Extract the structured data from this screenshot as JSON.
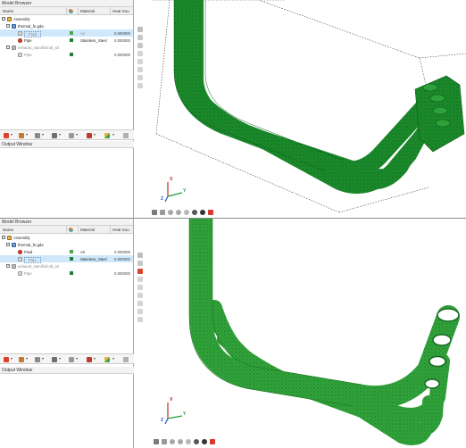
{
  "model_browser": {
    "title": "Model Browser",
    "columns": {
      "name": "Name",
      "material": "Material",
      "heat_source": "Heat Sou"
    }
  },
  "top": {
    "assembly_label": "Assembly",
    "component_1": "thermal_fe.gda",
    "part_fluid": "Fluid",
    "part_fluid_material": "Air",
    "part_fluid_heat": "0.000000",
    "part_pipe": "Pipe",
    "part_pipe_material": "Stainless_Steel",
    "part_pipe_heat": "0.000000",
    "component_2": "exhaust_manifold.stl_txt",
    "part_pipe2": "Pipe",
    "part_pipe2_heat": "0.000000"
  },
  "bottom": {
    "assembly_label": "Assembly",
    "component_1": "thermal_fe.gda",
    "part_fluid": "Fluid",
    "part_fluid_material": "Air",
    "part_fluid_heat": "0.000000",
    "part_pipe": "Pipe",
    "part_pipe_material": "Stainless_Steel",
    "part_pipe_heat": "0.000000",
    "component_2": "exhaust_manifold.stl_txt",
    "part_pipe2": "Pipe",
    "part_pipe2_heat": "0.000000"
  },
  "output_window": {
    "title": "Output Window"
  },
  "triad": {
    "x_label": "X",
    "y_label": "Y",
    "z_label": "Z"
  },
  "colors": {
    "mesh_green": "#1d8f2e",
    "mesh_light": "#3ab646",
    "selection_blue": "#cfe8fb",
    "swatch_air": "#4aa84a",
    "swatch_steel": "#1f7d3c"
  },
  "icons": [
    "expand-icon",
    "assembly-icon",
    "component-icon",
    "part-icon",
    "material-swatch-icon",
    "fit-view-icon",
    "zoom-icon",
    "rotate-icon",
    "shading-icon",
    "mesh-toggle-icon",
    "axis-triad-icon"
  ]
}
